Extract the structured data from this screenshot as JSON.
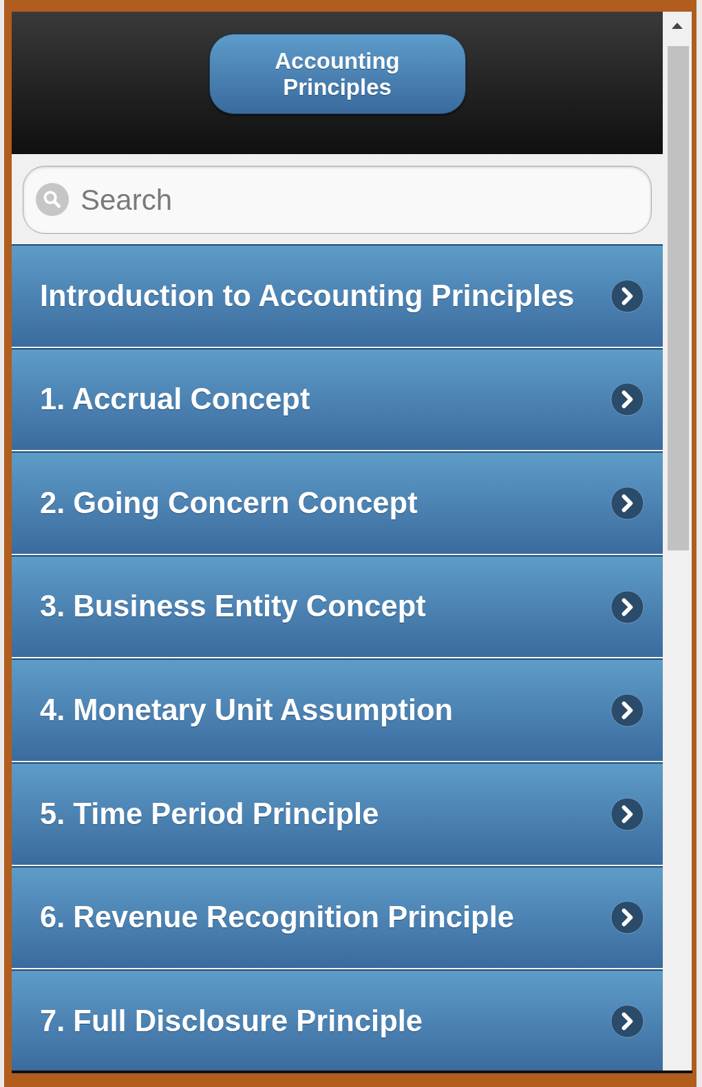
{
  "header": {
    "title_button": "Accounting Principles"
  },
  "search": {
    "placeholder": "Search"
  },
  "topics": [
    {
      "label": "Introduction to Accounting Principles"
    },
    {
      "label": "1. Accrual Concept"
    },
    {
      "label": "2. Going Concern Concept"
    },
    {
      "label": "3. Business Entity Concept"
    },
    {
      "label": "4. Monetary Unit Assumption"
    },
    {
      "label": "5. Time Period Principle"
    },
    {
      "label": "6. Revenue Recognition Principle"
    },
    {
      "label": "7. Full Disclosure Principle"
    }
  ]
}
